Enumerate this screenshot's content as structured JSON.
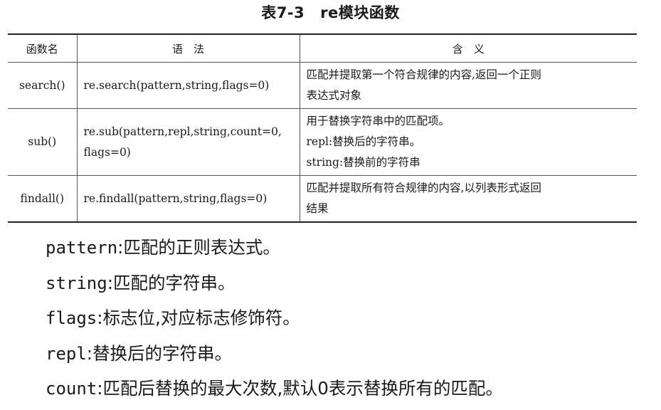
{
  "caption": {
    "number": "表7-3",
    "title": "re模块函数"
  },
  "table": {
    "headers": {
      "name": "函数名",
      "syntax": "语　法",
      "meaning": "含　义"
    },
    "rows": [
      {
        "name": "search()",
        "syntax": [
          "re.search(pattern,string,flags=0)"
        ],
        "meaning": [
          "匹配并提取第一个符合规律的内容,返回一个正则",
          "表达式对象"
        ]
      },
      {
        "name": "sub()",
        "syntax": [
          "re.sub(pattern,repl,string,count=0,",
          "flags=0)"
        ],
        "meaning": [
          "用于替换字符串中的匹配项。",
          "repl:替换后的字符串。",
          "string:替换前的字符串"
        ]
      },
      {
        "name": "findall()",
        "syntax": [
          "re.findall(pattern,string,flags=0)"
        ],
        "meaning": [
          "匹配并提取所有符合规律的内容,以列表形式返回",
          "结果"
        ]
      }
    ]
  },
  "definitions": [
    {
      "term": "pattern",
      "sep": ":",
      "desc": "匹配的正则表达式。"
    },
    {
      "term": "string",
      "sep": ":",
      "desc": "匹配的字符串。"
    },
    {
      "term": "flags",
      "sep": ":",
      "desc": "标志位,对应标志修饰符。"
    },
    {
      "term": "repl",
      "sep": ":",
      "desc": "替换后的字符串。"
    },
    {
      "term": "count",
      "sep": ":",
      "desc": "匹配后替换的最大次数,默认0表示替换所有的匹配。"
    }
  ]
}
